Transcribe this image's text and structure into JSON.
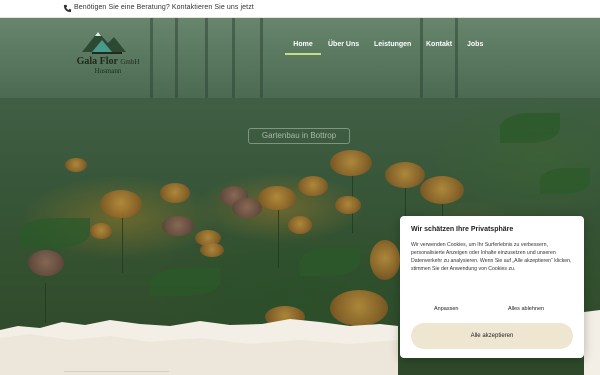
{
  "topbar": {
    "icon": "phone-icon",
    "message": "Benötigen Sie eine Beratung? Kontaktieren Sie uns jetzt"
  },
  "logo": {
    "brand": "Gala Flor",
    "suffix": "GmbH",
    "sub": "Husmann"
  },
  "nav": {
    "items": [
      "Home",
      "Über Uns",
      "Leistungen",
      "Kontakt",
      "Jobs"
    ],
    "active": "Home",
    "accent": "#c8d98a"
  },
  "hero": {
    "title": "Gartenbau in Bottrop"
  },
  "cookie": {
    "title": "Wir schätzen Ihre Privatsphäre",
    "text": "Wir verwenden Cookies, um Ihr Surferlebnis zu verbessern, personalisierte Anzeigen oder Inhalte einzusetzen und unseren Datenverkehr zu analysieren. Wenn Sie auf „Alle akzeptieren“ klicken, stimmen Sie der Anwendung von Cookies zu.",
    "customize_label": "Anpassen",
    "reject_label": "Alles ablehnen",
    "accept_label": "Alle akzeptieren",
    "accept_color": "#efe6d2"
  }
}
